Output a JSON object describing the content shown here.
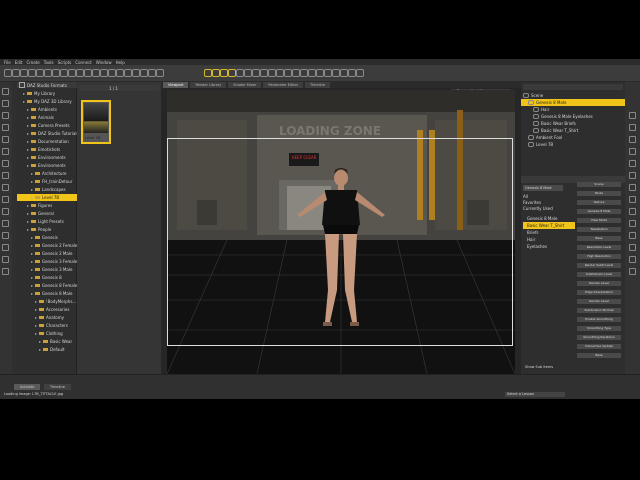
{
  "menu": [
    "File",
    "Edit",
    "Create",
    "Tools",
    "Scripts",
    "Connect",
    "Window",
    "Help"
  ],
  "left_tree": [
    {
      "label": "DAZ Studio Formats",
      "indent": 0
    },
    {
      "label": "My Library",
      "indent": 1
    },
    {
      "label": "My DAZ 3D Library",
      "indent": 1
    },
    {
      "label": "Ambients",
      "indent": 2
    },
    {
      "label": "Animals",
      "indent": 2
    },
    {
      "label": "Camera Presets",
      "indent": 2
    },
    {
      "label": "DAZ Studio Tutorials",
      "indent": 2
    },
    {
      "label": "Documentation",
      "indent": 2
    },
    {
      "label": "Emotishots",
      "indent": 2
    },
    {
      "label": "Environments",
      "indent": 2
    },
    {
      "label": "Environments",
      "indent": 2
    },
    {
      "label": "Architecture",
      "indent": 3
    },
    {
      "label": "FH_trainDetour",
      "indent": 3
    },
    {
      "label": "Landscapes",
      "indent": 3
    },
    {
      "label": "Level 7B",
      "indent": 3,
      "selected": true
    },
    {
      "label": "Figures",
      "indent": 2
    },
    {
      "label": "General",
      "indent": 2
    },
    {
      "label": "Light Presets",
      "indent": 2
    },
    {
      "label": "People",
      "indent": 2
    },
    {
      "label": "Genesis",
      "indent": 3
    },
    {
      "label": "Genesis 2 Female",
      "indent": 3
    },
    {
      "label": "Genesis 2 Male",
      "indent": 3
    },
    {
      "label": "Genesis 3 Female",
      "indent": 3
    },
    {
      "label": "Genesis 3 Male",
      "indent": 3
    },
    {
      "label": "Genesis 8",
      "indent": 3
    },
    {
      "label": "Genesis 8 Female",
      "indent": 3
    },
    {
      "label": "Genesis 8 Male",
      "indent": 3
    },
    {
      "label": "!BodyMorphs...",
      "indent": 4
    },
    {
      "label": "Accessories",
      "indent": 4
    },
    {
      "label": "Anatomy",
      "indent": 4
    },
    {
      "label": "Characters",
      "indent": 4
    },
    {
      "label": "Clothing",
      "indent": 4
    },
    {
      "label": "Basic Wear",
      "indent": 5
    },
    {
      "label": "Default",
      "indent": 5
    }
  ],
  "content": {
    "breadcrumb": "1 / 1",
    "thumb_label": "Level 7B"
  },
  "viewport": {
    "tabs": [
      "Viewport",
      "Render Library",
      "Shader Mixer",
      "Parameter Editor",
      "Timeline"
    ],
    "active_tab": "Viewport",
    "view_label": "Perspective View",
    "sign_text": "LOADING ZONE",
    "warning_sign": "KEEP CLEAR"
  },
  "scene_tree": [
    {
      "label": "Scene",
      "indent": 0
    },
    {
      "label": "Genesis 8 Male",
      "indent": 1,
      "selected": true
    },
    {
      "label": "Hair",
      "indent": 2
    },
    {
      "label": "Genesis 8 Male Eyelashes",
      "indent": 2
    },
    {
      "label": "Basic Wear Briefs",
      "indent": 2
    },
    {
      "label": "Basic Wear T_Shirt",
      "indent": 2
    },
    {
      "label": "Ambient Fool",
      "indent": 1
    },
    {
      "label": "Level 7B",
      "indent": 1
    }
  ],
  "surfaces": {
    "dropdown": "Genesis 8 Male",
    "groups": [
      "All",
      "Favorites",
      "Currently Used"
    ],
    "items": [
      "Genesis 8 Male",
      "Basic Wear T_Shirt",
      "Briefs",
      "Hair",
      "Eyelashes"
    ],
    "props": [
      "Scene",
      "Mode",
      "Texture",
      "Genesis 8 Male",
      "View Mode",
      "Tessellation",
      "Base",
      "Resolution Level",
      "High Resolution",
      "Render SubD Level",
      "SubDivision Level",
      "Render Level",
      "Edge Interpolation",
      "Render Level",
      "Subdivision Normal",
      "Enable Smoothing",
      "Smoothing Type",
      "Smoothing Iterations",
      "Interactive Update",
      "Base"
    ],
    "show_sub": "Show Sub Items"
  },
  "status": {
    "tabs": [
      "Activate",
      "Timeline"
    ],
    "left_text": "Loading image: L7B_TITTACLE.jpg",
    "lesson": "Select a Lesson"
  }
}
